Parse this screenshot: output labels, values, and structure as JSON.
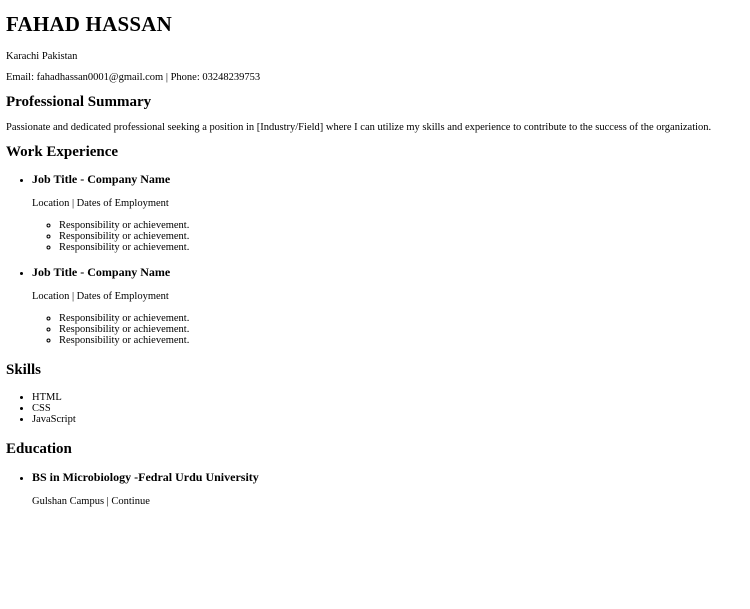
{
  "resume": {
    "name": "FAHAD HASSAN",
    "location": "Karachi Pakistan",
    "contact": "Email: fahadhassan0001@gmail.com | Phone: 03248239753"
  },
  "summary": {
    "heading": "Professional Summary",
    "text": "Passionate and dedicated professional seeking a position in [Industry/Field] where I can utilize my skills and experience to contribute to the success of the organization."
  },
  "work": {
    "heading": "Work Experience",
    "jobs": [
      {
        "title": "Job Title - Company Name",
        "meta": "Location | Dates of Employment",
        "items": [
          "Responsibility or achievement.",
          "Responsibility or achievement.",
          "Responsibility or achievement."
        ]
      },
      {
        "title": "Job Title - Company Name",
        "meta": "Location | Dates of Employment",
        "items": [
          "Responsibility or achievement.",
          "Responsibility or achievement.",
          "Responsibility or achievement."
        ]
      }
    ]
  },
  "skills": {
    "heading": "Skills",
    "items": [
      "HTML",
      "CSS",
      "JavaScript"
    ]
  },
  "education": {
    "heading": "Education",
    "entries": [
      {
        "degree": "BS in Microbiology -Fedral Urdu University",
        "meta": "Gulshan Campus | Continue"
      }
    ]
  }
}
